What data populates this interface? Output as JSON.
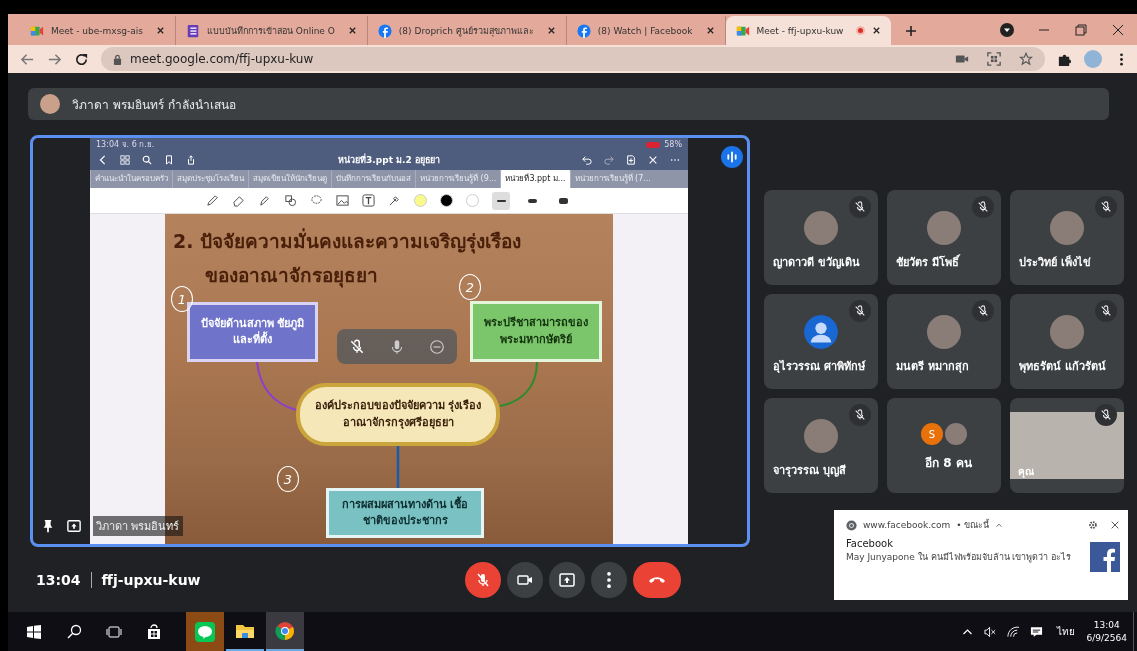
{
  "browser": {
    "tabs": [
      {
        "title": "Meet - ube-mxsg-ais",
        "kind": "meet",
        "selected": false,
        "recording": false
      },
      {
        "title": "แบบบันทึกการเข้าสอน Online O",
        "kind": "form",
        "selected": false,
        "recording": false
      },
      {
        "title": "(8) Droprich ศูนย์รวมสุขภาพและ",
        "kind": "facebook",
        "selected": false,
        "recording": false
      },
      {
        "title": "(8) Watch | Facebook",
        "kind": "facebook",
        "selected": false,
        "recording": false
      },
      {
        "title": "Meet - ffj-upxu-kuw",
        "kind": "meet",
        "selected": true,
        "recording": true
      }
    ],
    "url": "meet.google.com/ffj-upxu-kuw"
  },
  "meeting": {
    "presenter_banner": "วิภาดา พรมอินทร์ กำลังนำเสนอ",
    "shared_screen": {
      "status_time": "13:04  จ. 6 ก.ย.",
      "battery": "58%",
      "document_title": "หน่วยที่3.ppt ม.2 อยุธยา",
      "doc_tabs": [
        {
          "label": "คำแนะนำในครอบครัว",
          "selected": false
        },
        {
          "label": "สมุดประชุมโรงเรียน",
          "selected": false
        },
        {
          "label": "สมุดเขียนให้นักเรียนดู",
          "selected": false
        },
        {
          "label": "บันทึกการเรียนกับนอส",
          "selected": false
        },
        {
          "label": "หน่วยการเรียนรู้ที่ (9...",
          "selected": false
        },
        {
          "label": "หน่วยที่3.ppt ม...",
          "selected": true
        },
        {
          "label": "หน่วยการเรียนรู้ที่ (7...",
          "selected": false
        }
      ],
      "swatches": [
        {
          "color": "#fafa8c"
        },
        {
          "color": "#000000"
        },
        {
          "color": "#ffffff"
        }
      ],
      "stroke_sizes": [
        {
          "selected": true
        },
        {
          "selected": false
        },
        {
          "selected": false
        }
      ],
      "slide": {
        "title_line_1": "2. ปัจจัยความมั่นคงและความเจริญรุ่งเรือง",
        "title_line_2": "ของอาณาจักรอยุธยา",
        "box_left": "ปัจจัยด้านสภาพ ชัยภูมิและที่ตั้ง",
        "box_right": "พระปรีชาสามารถของ พระมหากษัตริย์",
        "center": "องค์ประกอบของปัจจัยความ รุ่งเรืองอาณาจักรกรุงศรีอยุธยา",
        "box_bottom": "การผสมผสานทางด้าน เชื้อชาติของประชากร",
        "marks": [
          "1",
          "2",
          "3"
        ]
      },
      "presenter_name": "วิภาดา พรมอินทร์"
    },
    "participants": [
      {
        "name": "ญาดาวดี ขวัญเดิน",
        "kind": "photo",
        "muted": true
      },
      {
        "name": "ชัยวัตร มีโพธิ์",
        "kind": "photo",
        "muted": true
      },
      {
        "name": "ประวิทย์ เพ็งไข่",
        "kind": "photo",
        "muted": true
      },
      {
        "name": "อุไรวรรณ ศาพิทักษ์",
        "kind": "default",
        "muted": true
      },
      {
        "name": "มนตรี หมากสุก",
        "kind": "photo",
        "muted": true
      },
      {
        "name": "พุทธรัตน์ แก้วรัตน์",
        "kind": "photo",
        "muted": true
      },
      {
        "name": "จารุวรรณ บุญสี",
        "kind": "photo",
        "muted": true
      },
      {
        "name": "อีก 8 คน",
        "kind": "more",
        "initial": "S",
        "muted": false
      },
      {
        "name": "คุณ",
        "kind": "self",
        "muted": true
      }
    ],
    "time": "13:04",
    "code": "ffj-upxu-kuw",
    "controls": [
      {
        "kind": "mic",
        "on": false
      },
      {
        "kind": "camera",
        "on": true
      },
      {
        "kind": "present"
      },
      {
        "kind": "more"
      },
      {
        "kind": "leave"
      }
    ]
  },
  "notification": {
    "source": "www.facebook.com",
    "when": "• ขณะนี้",
    "title": "Facebook",
    "body": "May Junyapone ใน คนมีไฟพร้อมจับล้าน เขาพูดว่า อะไร"
  },
  "taskbar": {
    "language": "ไทย",
    "time": "13:04",
    "date": "6/9/2564"
  }
}
